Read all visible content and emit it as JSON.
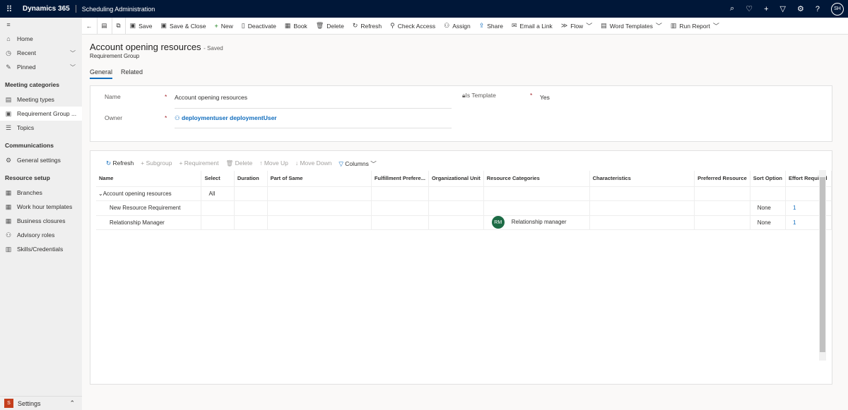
{
  "header": {
    "brand": "Dynamics 365",
    "app": "Scheduling Administration",
    "user_initials": "SH"
  },
  "sidebar": {
    "items": [
      {
        "label": "Home",
        "icon": "home-icon"
      },
      {
        "label": "Recent",
        "icon": "clock-icon"
      },
      {
        "label": "Pinned",
        "icon": "pin-icon"
      }
    ],
    "sections": [
      {
        "title": "Meeting categories",
        "items": [
          "Meeting types",
          "Requirement Group ...",
          "Topics"
        ]
      },
      {
        "title": "Communications",
        "items": [
          "General settings"
        ]
      },
      {
        "title": "Resource setup",
        "items": [
          "Branches",
          "Work hour templates",
          "Business closures",
          "Advisory roles",
          "Skills/Credentials"
        ]
      }
    ],
    "area": {
      "badge": "S",
      "label": "Settings"
    }
  },
  "toolbar": [
    "Save",
    "Save & Close",
    "New",
    "Deactivate",
    "Book",
    "Delete",
    "Refresh",
    "Check Access",
    "Assign",
    "Share",
    "Email a Link",
    "Flow",
    "Word Templates",
    "Run Report"
  ],
  "record": {
    "title": "Account opening resources",
    "status": "- Saved",
    "entity": "Requirement Group",
    "tabs": [
      "General",
      "Related"
    ]
  },
  "form": {
    "name_label": "Name",
    "name_value": "Account opening resources",
    "owner_label": "Owner",
    "owner_value": "deploymentuser deploymentUser",
    "template_label": "Is Template",
    "template_value": "Yes"
  },
  "grid": {
    "toolbar": [
      "Refresh",
      "Subgroup",
      "Requirement",
      "Delete",
      "Move Up",
      "Move Down",
      "Columns"
    ],
    "columns": [
      "Name",
      "Select",
      "Duration",
      "Part of Same",
      "Fulfillment Prefere...",
      "Organizational Unit",
      "Resource Categories",
      "Characteristics",
      "Preferred Resource",
      "Sort Option",
      "Effort Required"
    ],
    "rows": [
      {
        "name": "Account opening resources",
        "select": "All",
        "category_initials": "",
        "category": "",
        "sort": "",
        "effort": ""
      },
      {
        "name": "New Resource Requirement",
        "select": "",
        "category_initials": "",
        "category": "",
        "sort": "None",
        "effort": "1"
      },
      {
        "name": "Relationship Manager",
        "select": "",
        "category_initials": "RM",
        "category": "Relationship manager",
        "sort": "None",
        "effort": "1"
      }
    ]
  }
}
